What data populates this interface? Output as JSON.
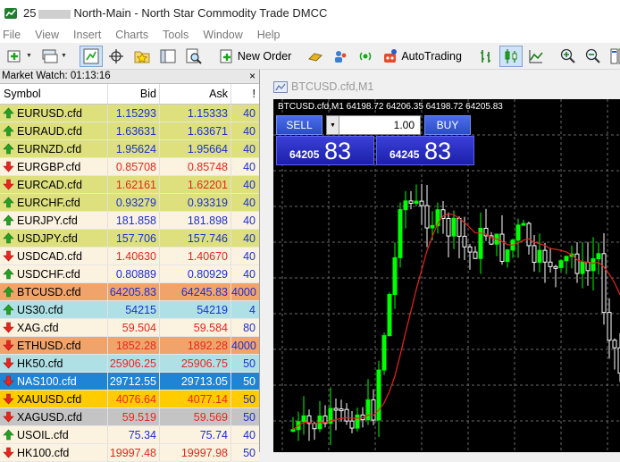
{
  "window": {
    "title_prefix": "25",
    "title_rest": "North-Main - North Star Commodity Trade DMCC"
  },
  "menu": [
    "File",
    "View",
    "Insert",
    "Charts",
    "Tools",
    "Window",
    "Help"
  ],
  "toolbar": {
    "new_order": "New Order",
    "autotrading": "AutoTrading"
  },
  "market_watch": {
    "title": "Market Watch: 01:13:16",
    "close": "×",
    "columns": {
      "symbol": "Symbol",
      "bid": "Bid",
      "ask": "Ask",
      "spread": "!"
    },
    "rows": [
      {
        "symbol": "EURUSD.cfd",
        "bid": "1.15293",
        "ask": "1.15333",
        "spread": "40",
        "dir": "up",
        "bg": "#dde07c"
      },
      {
        "symbol": "EURAUD.cfd",
        "bid": "1.63631",
        "ask": "1.63671",
        "spread": "40",
        "dir": "up",
        "bg": "#dde07c"
      },
      {
        "symbol": "EURNZD.cfd",
        "bid": "1.95624",
        "ask": "1.95664",
        "spread": "40",
        "dir": "up",
        "bg": "#dde07c"
      },
      {
        "symbol": "EURGBP.cfd",
        "bid": "0.85708",
        "ask": "0.85748",
        "spread": "40",
        "dir": "dn",
        "bg": "#fbf2e0"
      },
      {
        "symbol": "EURCAD.cfd",
        "bid": "1.62161",
        "ask": "1.62201",
        "spread": "40",
        "dir": "dn",
        "bg": "#dde07c"
      },
      {
        "symbol": "EURCHF.cfd",
        "bid": "0.93279",
        "ask": "0.93319",
        "spread": "40",
        "dir": "up",
        "bg": "#dde07c"
      },
      {
        "symbol": "EURJPY.cfd",
        "bid": "181.858",
        "ask": "181.898",
        "spread": "40",
        "dir": "up",
        "bg": "#fbf2e0"
      },
      {
        "symbol": "USDJPY.cfd",
        "bid": "157.706",
        "ask": "157.746",
        "spread": "40",
        "dir": "up",
        "bg": "#dde07c"
      },
      {
        "symbol": "USDCAD.cfd",
        "bid": "1.40630",
        "ask": "1.40670",
        "spread": "40",
        "dir": "dn",
        "bg": "#fbf2e0"
      },
      {
        "symbol": "USDCHF.cfd",
        "bid": "0.80889",
        "ask": "0.80929",
        "spread": "40",
        "dir": "up",
        "bg": "#fbf2e0"
      },
      {
        "symbol": "BTCUSD.cfd",
        "bid": "64205.83",
        "ask": "64245.83",
        "spread": "4000",
        "dir": "up",
        "bg": "#f0a46c"
      },
      {
        "symbol": "US30.cfd",
        "bid": "54215",
        "ask": "54219",
        "spread": "4",
        "dir": "up",
        "bg": "#aee0e6"
      },
      {
        "symbol": "XAG.cfd",
        "bid": "59.504",
        "ask": "59.584",
        "spread": "80",
        "dir": "dn",
        "bg": "#fbf2e0"
      },
      {
        "symbol": "ETHUSD.cfd",
        "bid": "1852.28",
        "ask": "1892.28",
        "spread": "4000",
        "dir": "dn",
        "bg": "#f0a46c"
      },
      {
        "symbol": "HK50.cfd",
        "bid": "25906.25",
        "ask": "25906.75",
        "spread": "50",
        "dir": "dn",
        "bg": "#aee0e6"
      },
      {
        "symbol": "NAS100.cfd",
        "bid": "29712.55",
        "ask": "29713.05",
        "spread": "50",
        "dir": "dn",
        "bg": "#1f84d6",
        "text": "#ffffff"
      },
      {
        "symbol": "XAUUSD.cfd",
        "bid": "4076.64",
        "ask": "4077.14",
        "spread": "50",
        "dir": "dn",
        "bg": "#ffcc00"
      },
      {
        "symbol": "XAGUSD.cfd",
        "bid": "59.519",
        "ask": "59.569",
        "spread": "50",
        "dir": "dn",
        "bg": "#c4c4c4"
      },
      {
        "symbol": "USOIL.cfd",
        "bid": "75.34",
        "ask": "75.74",
        "spread": "40",
        "dir": "up",
        "bg": "#fbf2e0"
      },
      {
        "symbol": "HK100.cfd",
        "bid": "19997.48",
        "ask": "19997.98",
        "spread": "50",
        "dir": "dn",
        "bg": "#fbf2e0"
      }
    ]
  },
  "chart_window": {
    "tab": "BTCUSD.cfd,M1",
    "label": "BTCUSD.cfd,M1  64198.72 64206.35 64198.72 64205.83",
    "sell": "SELL",
    "buy": "BUY",
    "volume": "1.00",
    "sell_small": "64205",
    "sell_big": "83",
    "buy_small": "64245",
    "buy_big": "83",
    "colors": {
      "bull": "#00ff00",
      "bear": "#ffffff",
      "ma": "#e8261e",
      "grid": "#6a6a6a"
    }
  }
}
